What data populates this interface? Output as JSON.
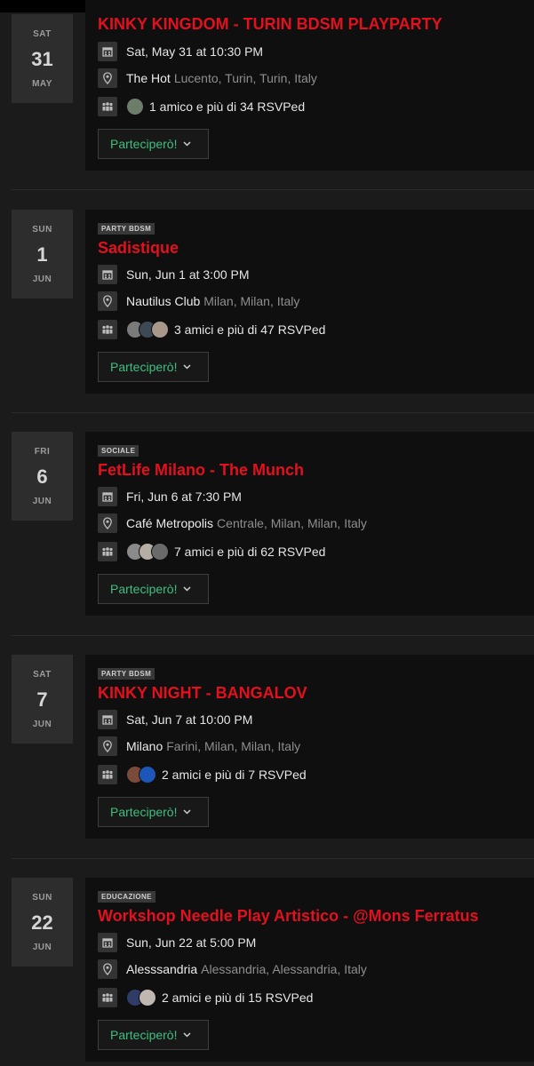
{
  "colors": {
    "accent_title": "#e3101e",
    "action_green": "#3fbf7f",
    "background": "#1b1b1b",
    "card": "#0f0f0f"
  },
  "events": [
    {
      "dow": "SAT",
      "day": "31",
      "month": "MAY",
      "tag": "",
      "title": "KINKY KINGDOM - TURIN BDSM PLAYPARTY",
      "when": "Sat, May 31 at 10:30 PM",
      "venue": "The Hot",
      "address": "Lucento, Turin, Turin, Italy",
      "rsvp": "1 amico e più di 34 RSVPed",
      "avatar_colors": [
        "#6e7d6a"
      ],
      "button": "Parteciperò!"
    },
    {
      "dow": "SUN",
      "day": "1",
      "month": "JUN",
      "tag": "PARTY BDSM",
      "title": "Sadistique",
      "when": "Sun, Jun 1 at 3:00 PM",
      "venue": "Nautilus Club",
      "address": "Milan, Milan, Italy",
      "rsvp": "3 amici e più di 47 RSVPed",
      "avatar_colors": [
        "#7a7a7a",
        "#3d4a55",
        "#a8978a"
      ],
      "button": "Parteciperò!"
    },
    {
      "dow": "FRI",
      "day": "6",
      "month": "JUN",
      "tag": "SOCIALE",
      "title": "FetLife Milano - The Munch",
      "when": "Fri, Jun 6 at 7:30 PM",
      "venue": "Café Metropolis",
      "address": "Centrale, Milan, Milan, Italy",
      "rsvp": "7 amici e più di 62 RSVPed",
      "avatar_colors": [
        "#8a8a8a",
        "#b5aea5",
        "#6a6a6a"
      ],
      "button": "Parteciperò!"
    },
    {
      "dow": "SAT",
      "day": "7",
      "month": "JUN",
      "tag": "PARTY BDSM",
      "title": "KINKY NIGHT - BANGALOV",
      "when": "Sat, Jun 7 at 10:00 PM",
      "venue": "Milano",
      "address": "Farini, Milan, Milan, Italy",
      "rsvp": "2 amici e più di 7 RSVPed",
      "avatar_colors": [
        "#7a4a3a",
        "#1e56b8"
      ],
      "button": "Parteciperò!"
    },
    {
      "dow": "SUN",
      "day": "22",
      "month": "JUN",
      "tag": "EDUCAZIONE",
      "title": "Workshop Needle Play Artistico - @Mons Ferratus",
      "when": "Sun, Jun 22 at 5:00 PM",
      "venue": "Alesssandria",
      "address": "Alessandria, Alessandria, Italy",
      "rsvp": "2 amici e più di 15 RSVPed",
      "avatar_colors": [
        "#2f3c66",
        "#c0b8b0"
      ],
      "button": "Parteciperò!"
    }
  ]
}
